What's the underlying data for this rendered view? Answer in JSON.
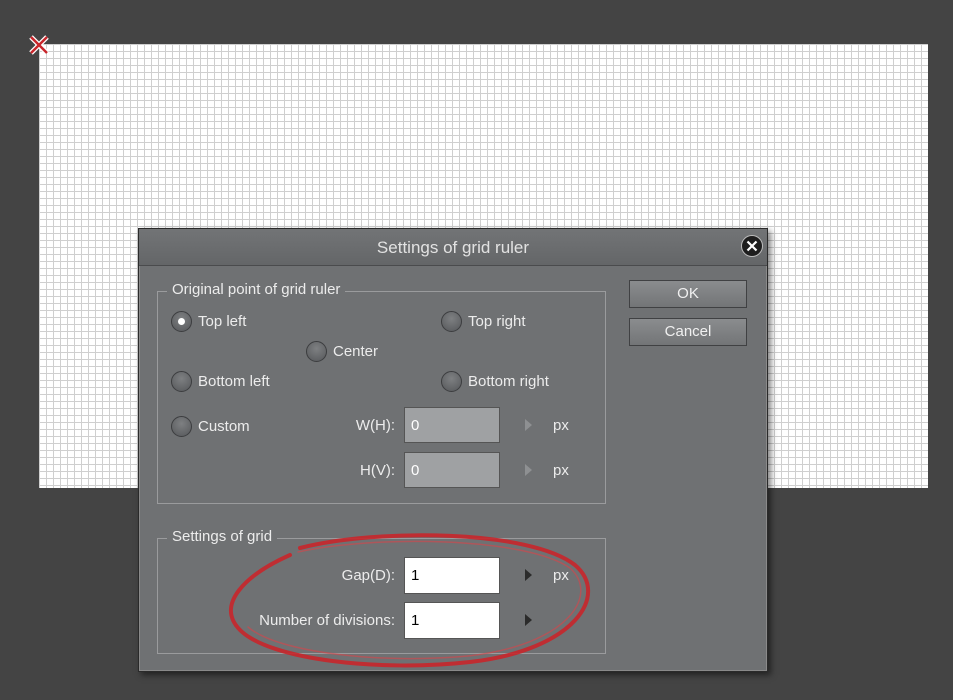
{
  "dialog": {
    "title": "Settings of grid ruler",
    "ok_label": "OK",
    "cancel_label": "Cancel"
  },
  "origin_group": {
    "label": "Original point of grid ruler",
    "options": {
      "top_left": "Top left",
      "top_right": "Top right",
      "center": "Center",
      "bottom_left": "Bottom left",
      "bottom_right": "Bottom right",
      "custom": "Custom"
    },
    "selected": "Top left",
    "w_label": "W(H):",
    "w_value": "0",
    "h_label": "H(V):",
    "h_value": "0",
    "unit": "px"
  },
  "grid_group": {
    "label": "Settings of grid",
    "gap_label": "Gap(D):",
    "gap_value": "1",
    "gap_unit": "px",
    "divisions_label": "Number of divisions:",
    "divisions_value": "1"
  },
  "colors": {
    "background": "#444444",
    "dialog": "#6f7173",
    "annotation_circle": "#c8262b",
    "origin_marker": "#c8262b"
  },
  "icons": {
    "origin_marker": "x-mark-icon",
    "close": "close-icon",
    "spin": "triangle-right-icon"
  }
}
